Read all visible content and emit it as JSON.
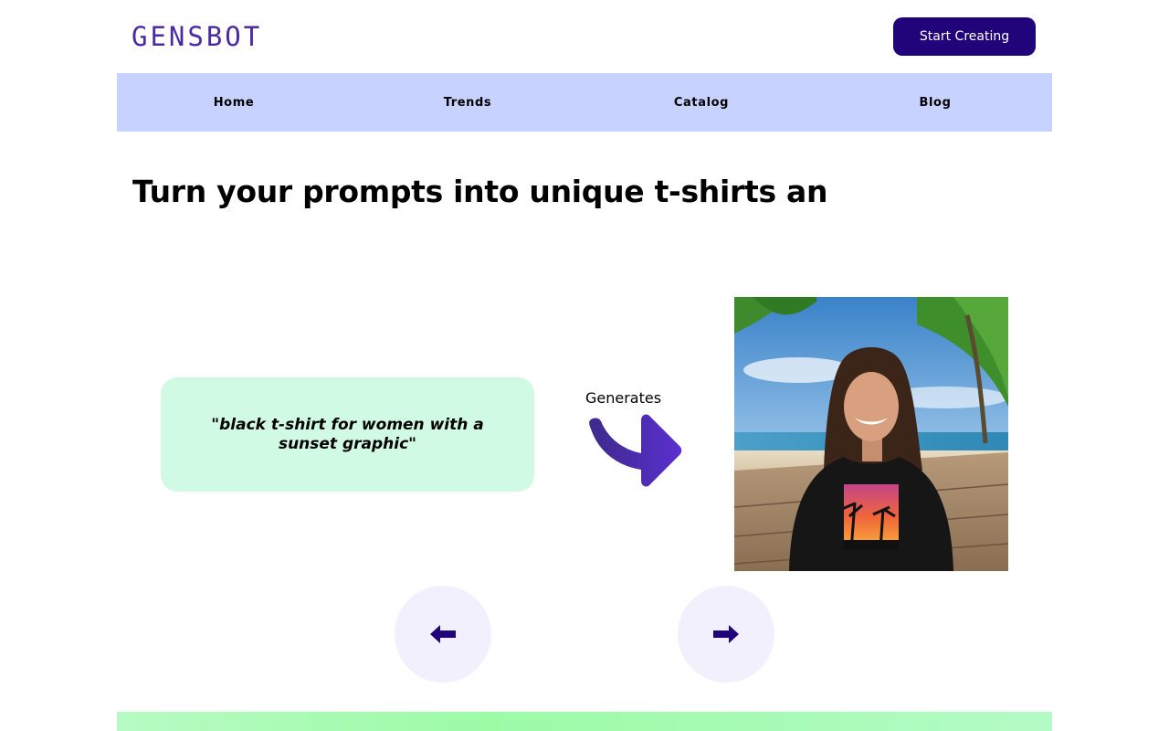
{
  "header": {
    "logo_text": "GENSBOT",
    "cta_label": "Start Creating"
  },
  "nav": {
    "items": [
      {
        "label": "Home"
      },
      {
        "label": "Trends"
      },
      {
        "label": "Catalog"
      },
      {
        "label": "Blog"
      }
    ]
  },
  "hero": {
    "title": "Turn your prompts into unique t-shirts an"
  },
  "demo": {
    "prompt": "\"black t-shirt for women with a sunset graphic\"",
    "generates_label": "Generates",
    "image_alt": "Woman wearing black t-shirt with sunset palm tree graphic on a beach"
  },
  "carousel": {
    "prev_icon": "arrow-left-icon",
    "next_icon": "arrow-right-icon"
  },
  "colors": {
    "brand_dark": "#22047a",
    "logo": "#4b2aa6",
    "nav_bg": "#c7d2fe",
    "prompt_bg": "#d1fae5",
    "carousel_btn_bg": "#f3f0fd"
  }
}
